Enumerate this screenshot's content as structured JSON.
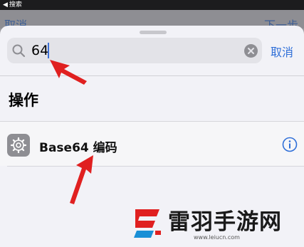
{
  "status_bar": {
    "back_arrow": "◀",
    "back_label": "搜索"
  },
  "background_nav": {
    "left_label": "取消",
    "right_label": "下一步"
  },
  "search": {
    "value": "64",
    "cancel_label": "取消"
  },
  "section": {
    "title": "操作"
  },
  "results": [
    {
      "icon": "gear-icon",
      "label": "Base64 编码"
    }
  ],
  "watermark": {
    "name": "雷羽手游网",
    "url": "www.leiucn.com"
  },
  "colors": {
    "accent": "#2f6fd8",
    "annotation_arrow": "#e02020",
    "sheet_bg": "#f2f2f7",
    "icon_bg": "#8e8e93"
  }
}
